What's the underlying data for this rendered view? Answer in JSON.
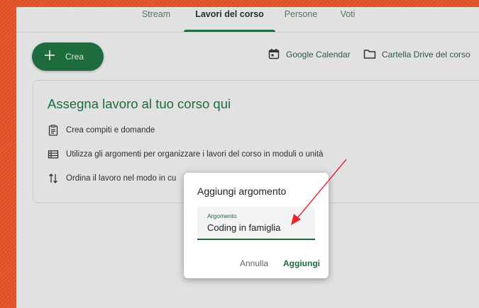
{
  "tabs": [
    {
      "label": "Stream"
    },
    {
      "label": "Lavori del corso",
      "active": true
    },
    {
      "label": "Persone"
    },
    {
      "label": "Voti"
    }
  ],
  "create_button": {
    "label": "Crea",
    "icon": "plus-icon"
  },
  "links": {
    "calendar": {
      "label": "Google Calendar",
      "icon": "calendar-icon"
    },
    "drive": {
      "label": "Cartella Drive del corso",
      "icon": "folder-icon"
    }
  },
  "card": {
    "title": "Assegna lavoro al tuo corso qui",
    "rows": [
      {
        "text": "Crea compiti e domande",
        "icon": "assignment-icon"
      },
      {
        "text": "Utilizza gli argomenti per organizzare i lavori del corso in moduli o unità",
        "icon": "topic-list-icon"
      },
      {
        "text": "Ordina il lavoro nel modo in cu",
        "icon": "reorder-icon"
      }
    ]
  },
  "dialog": {
    "title": "Aggiungi argomento",
    "field_label": "Argomento",
    "field_value": "Coding in famiglia",
    "cancel_label": "Annulla",
    "add_label": "Aggiungi"
  },
  "colors": {
    "accent": "#1e6b3b",
    "background": "#e1e1e1",
    "frame": "#e2562c",
    "annotation_arrow": "#e8252b"
  }
}
